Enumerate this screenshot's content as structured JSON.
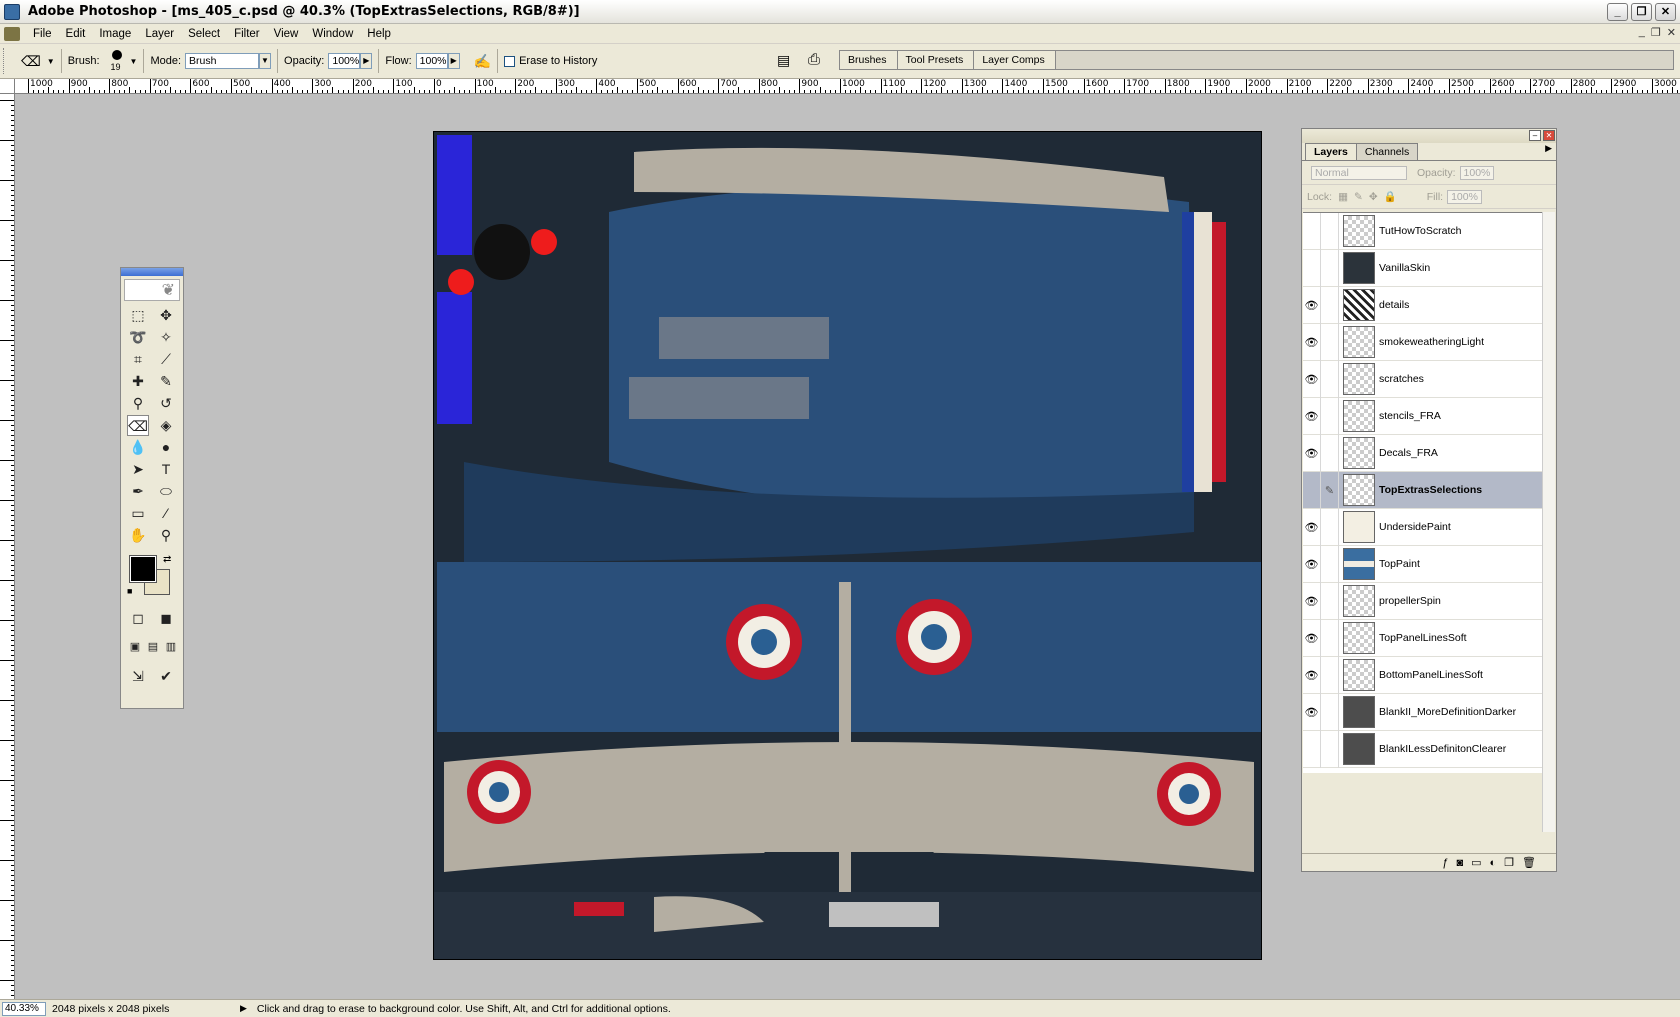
{
  "window": {
    "title": "Adobe Photoshop - [ms_405_c.psd @ 40.3% (TopExtrasSelections, RGB/8#)]",
    "min_label": "_",
    "max_label": "❐",
    "close_label": "✕",
    "doc_min": "_",
    "doc_max": "❐",
    "doc_close": "✕"
  },
  "menu": [
    "File",
    "Edit",
    "Image",
    "Layer",
    "Select",
    "Filter",
    "View",
    "Window",
    "Help"
  ],
  "options_bar": {
    "brush_label": "Brush:",
    "brush_size": "19",
    "mode_label": "Mode:",
    "mode_value": "Brush",
    "opacity_label": "Opacity:",
    "opacity_value": "100%",
    "flow_label": "Flow:",
    "flow_value": "100%",
    "erase_history_label": "Erase to History",
    "well_tabs": [
      "Brushes",
      "Tool Presets",
      "Layer Comps"
    ]
  },
  "ruler_h_labels": [
    "1000",
    "900",
    "800",
    "700",
    "600",
    "500",
    "400",
    "300",
    "200",
    "100",
    "0",
    "100",
    "200",
    "300",
    "400",
    "500",
    "600",
    "700",
    "800",
    "900",
    "1000",
    "1100",
    "1200",
    "1300",
    "1400",
    "1500",
    "1600",
    "1700",
    "1800",
    "1900",
    "2000",
    "2100",
    "2200",
    "2300",
    "2400",
    "2500",
    "2600",
    "2700",
    "2800",
    "2900",
    "3000"
  ],
  "layers_panel": {
    "tabs": [
      "Layers",
      "Channels"
    ],
    "blend_mode": "Normal",
    "opacity_label": "Opacity:",
    "opacity_value": "100%",
    "lock_label": "Lock:",
    "fill_label": "Fill:",
    "fill_value": "100%",
    "layers": [
      {
        "name": "TutHowToScratch",
        "visible": false,
        "selected": false,
        "thumb": "checker"
      },
      {
        "name": "VanillaSkin",
        "visible": false,
        "selected": false,
        "thumb": "dark"
      },
      {
        "name": "details",
        "visible": true,
        "selected": false,
        "thumb": "bw"
      },
      {
        "name": "smokeweatheringLight",
        "visible": true,
        "selected": false,
        "thumb": "checker"
      },
      {
        "name": "scratches",
        "visible": true,
        "selected": false,
        "thumb": "checker"
      },
      {
        "name": "stencils_FRA",
        "visible": true,
        "selected": false,
        "thumb": "checker"
      },
      {
        "name": "Decals_FRA",
        "visible": true,
        "selected": false,
        "thumb": "checker"
      },
      {
        "name": "TopExtrasSelections",
        "visible": false,
        "selected": true,
        "thumb": "checker"
      },
      {
        "name": "UndersidePaint",
        "visible": true,
        "selected": false,
        "thumb": "beige"
      },
      {
        "name": "TopPaint",
        "visible": true,
        "selected": false,
        "thumb": "blue"
      },
      {
        "name": "propellerSpin",
        "visible": true,
        "selected": false,
        "thumb": "checker"
      },
      {
        "name": "TopPanelLinesSoft",
        "visible": true,
        "selected": false,
        "thumb": "checker"
      },
      {
        "name": "BottomPanelLinesSoft",
        "visible": true,
        "selected": false,
        "thumb": "checker"
      },
      {
        "name": "BlankII_MoreDefinitionDarker",
        "visible": true,
        "selected": false,
        "thumb": "gray"
      },
      {
        "name": "BlankILessDefinitonClearer",
        "visible": false,
        "selected": false,
        "thumb": "gray"
      }
    ]
  },
  "status": {
    "zoom": "40.33%",
    "doc_size": "2048 pixels x 2048 pixels",
    "hint": "Click and drag to erase to background color.  Use Shift, Alt, and Ctrl for additional options."
  },
  "colors": {
    "foreground": "#000000",
    "background": "#e9e2c6",
    "skin_blue": "#2a4f7a",
    "skin_gray": "#b4aea2",
    "roundel_red": "#c3182a"
  }
}
